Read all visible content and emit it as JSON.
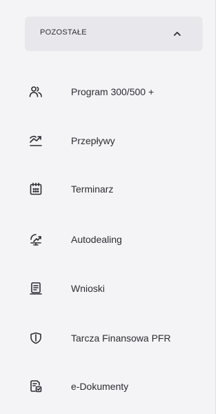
{
  "section": {
    "title": "POZOSTAŁE",
    "expanded": true,
    "chevron_icon": "chevron-up-icon"
  },
  "menu": {
    "items": [
      {
        "label": "Program 300/500 +",
        "icon": "people-icon"
      },
      {
        "label": "Przepływy",
        "icon": "flows-chart-icon"
      },
      {
        "label": "Terminarz",
        "icon": "calendar-icon"
      },
      {
        "label": "Autodealing",
        "icon": "exchange-icon"
      },
      {
        "label": "Wnioski",
        "icon": "document-icon"
      },
      {
        "label": "Tarcza Finansowa PFR",
        "icon": "shield-icon"
      },
      {
        "label": "e-Dokumenty",
        "icon": "e-document-icon"
      }
    ]
  },
  "colors": {
    "background": "#f4f4f6",
    "header_background": "#e8e8ec",
    "text": "#2b2b33",
    "icon": "#2b2b33"
  }
}
